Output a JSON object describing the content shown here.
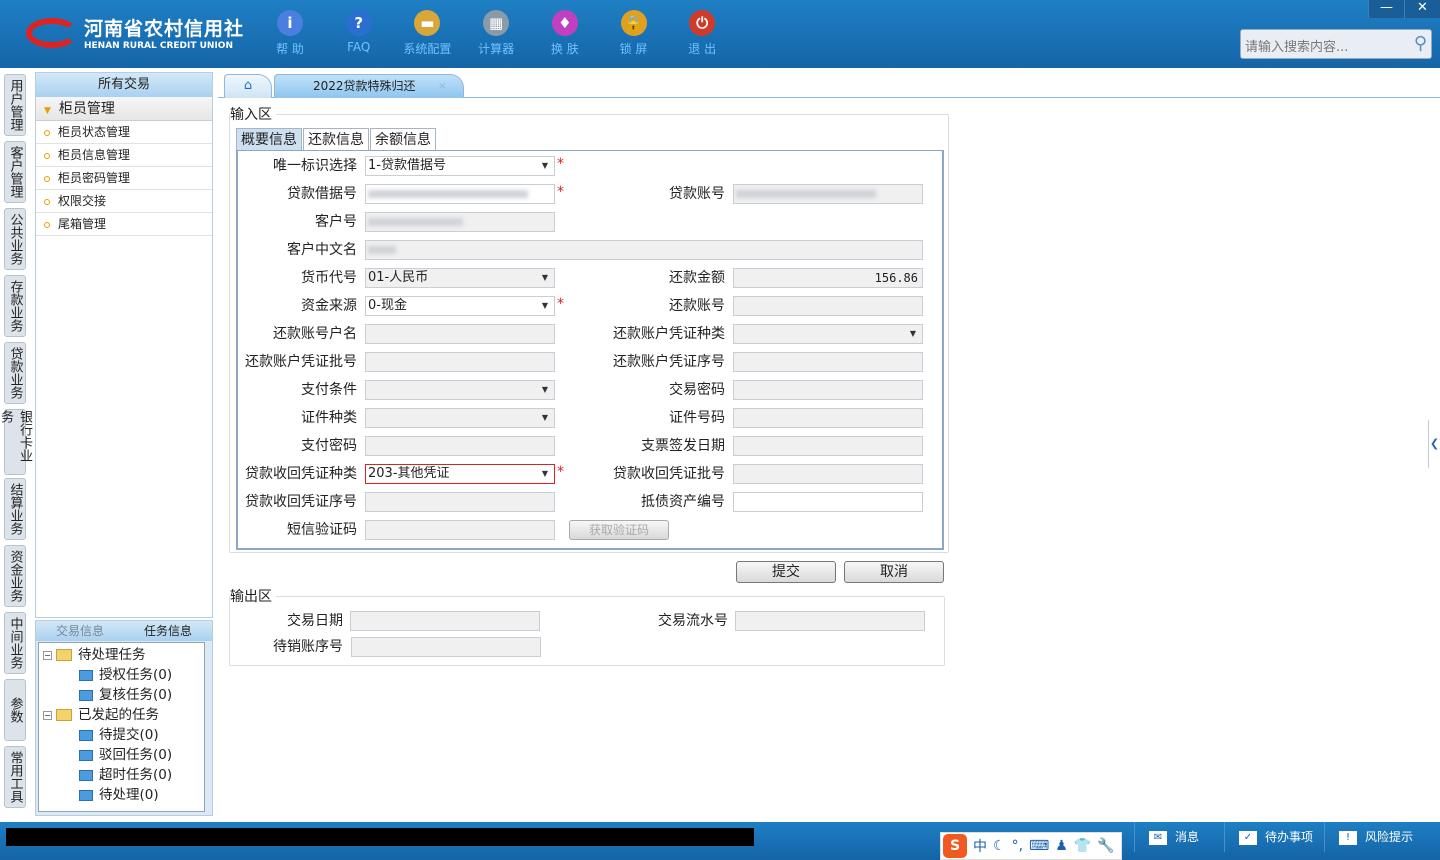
{
  "header": {
    "logo_cn": "河南省农村信用社",
    "logo_en": "HENAN RURAL CREDIT UNION",
    "tools": [
      {
        "icon": "info-icon",
        "label": "帮 助",
        "color": "#4a7fe0"
      },
      {
        "icon": "help-icon",
        "label": "FAQ",
        "color": "#2a6fd0"
      },
      {
        "icon": "toolbox-icon",
        "label": "系统配置",
        "color": "#d9a63a"
      },
      {
        "icon": "calculator-icon",
        "label": "计算器",
        "color": "#8a9aa8"
      },
      {
        "icon": "shirt-icon",
        "label": "换 肤",
        "color": "#c040c0"
      },
      {
        "icon": "lock-icon",
        "label": "锁 屏",
        "color": "#e0a020"
      },
      {
        "icon": "power-icon",
        "label": "退 出",
        "color": "#d03a2a"
      }
    ],
    "search_placeholder": "请输入搜索内容...",
    "win": {
      "minimize": "—",
      "close": "✕"
    }
  },
  "vtabs": [
    "用户管理",
    "客户管理",
    "公共业务",
    "存款业务",
    "贷款业务",
    "银行卡业务",
    "结算业务",
    "资金业务",
    "中间业务",
    "参数",
    "常用工具"
  ],
  "sidebar": {
    "title": "所有交易",
    "group": "柜员管理",
    "items": [
      "柜员状态管理",
      "柜员信息管理",
      "柜员密码管理",
      "权限交接",
      "尾箱管理"
    ]
  },
  "task": {
    "tabs": [
      "交易信息",
      "任务信息"
    ],
    "tree": [
      {
        "label": "待处理任务",
        "level": 0,
        "folder": true,
        "sign": "⊟"
      },
      {
        "label": "授权任务(0)",
        "level": 1
      },
      {
        "label": "复核任务(0)",
        "level": 1
      },
      {
        "label": "已发起的任务",
        "level": 0,
        "folder": true,
        "sign": "⊟"
      },
      {
        "label": "待提交(0)",
        "level": 1
      },
      {
        "label": "驳回任务(0)",
        "level": 1
      },
      {
        "label": "超时任务(0)",
        "level": 1
      },
      {
        "label": "待处理(0)",
        "level": 1
      }
    ]
  },
  "tabs": {
    "home": "⌂",
    "active": "2022贷款特殊归还",
    "close": "×"
  },
  "input_area": {
    "legend": "输入区",
    "subtabs": [
      "概要信息",
      "还款信息",
      "余额信息"
    ],
    "fields": {
      "unique_id_label": "唯一标识选择",
      "unique_id": "1-贷款借据号",
      "loan_no_label": "贷款借据号",
      "loan_acct_label": "贷款账号",
      "cust_no_label": "客户号",
      "cust_name_label": "客户中文名",
      "currency_label": "货币代号",
      "currency": "01-人民币",
      "repay_amount_label": "还款金额",
      "repay_amount": "156.86",
      "fund_src_label": "资金来源",
      "fund_src": "0-现金",
      "repay_acct_label": "还款账号",
      "repay_acct_name_label": "还款账号户名",
      "voucher_type_label": "还款账户凭证种类",
      "voucher_batch_label": "还款账户凭证批号",
      "voucher_seq_label": "还款账户凭证序号",
      "pay_cond_label": "支付条件",
      "trade_pwd_label": "交易密码",
      "id_type_label": "证件种类",
      "id_no_label": "证件号码",
      "pay_pwd_label": "支付密码",
      "check_date_label": "支票签发日期",
      "recv_type_label": "贷款收回凭证种类",
      "recv_type": "203-其他凭证",
      "recv_batch_label": "贷款收回凭证批号",
      "recv_seq_label": "贷款收回凭证序号",
      "asset_no_label": "抵债资产编号",
      "sms_label": "短信验证码",
      "sms_button": "获取验证码"
    }
  },
  "actions": {
    "submit": "提交",
    "cancel": "取消"
  },
  "output_area": {
    "legend": "输出区",
    "date_label": "交易日期",
    "serial_label": "交易流水号",
    "pending_label": "待销账序号"
  },
  "status": {
    "message": "消息",
    "todo": "待办事项",
    "risk": "风险提示"
  },
  "ime": {
    "logo": "S",
    "mode": "中",
    "items": [
      "☾",
      "°,",
      "⌨",
      "♟",
      "👕",
      "🔧"
    ]
  }
}
